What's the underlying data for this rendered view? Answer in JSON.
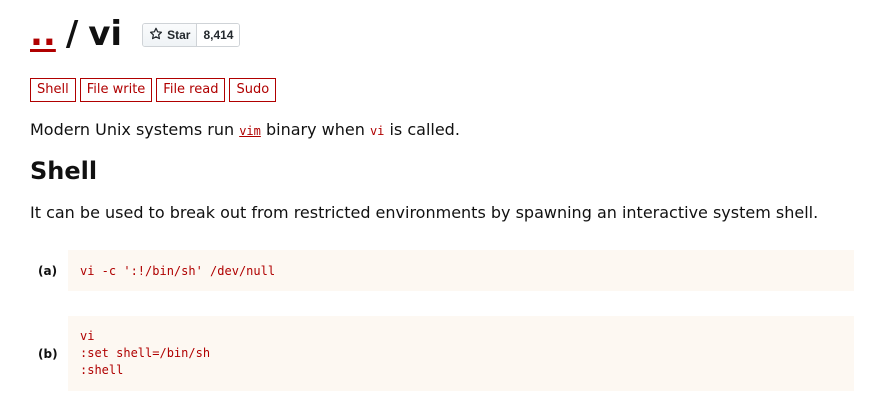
{
  "header": {
    "parent_link": "..",
    "separator": "/",
    "title": "vi",
    "github": {
      "star_label": "Star",
      "star_count": "8,414",
      "icon": "star-icon"
    }
  },
  "tags": [
    "Shell",
    "File write",
    "File read",
    "Sudo"
  ],
  "intro": {
    "prefix": "Modern Unix systems run ",
    "link_code": "vim",
    "middle": " binary when ",
    "code": "vi",
    "suffix": " is called."
  },
  "shell_section": {
    "title": "Shell",
    "description": "It can be used to break out from restricted environments by spawning an interactive system shell.",
    "examples": [
      {
        "label": "(a)",
        "code": "vi -c ':!/bin/sh' /dev/null"
      },
      {
        "label": "(b)",
        "code": "vi\n:set shell=/bin/sh\n:shell"
      }
    ]
  }
}
